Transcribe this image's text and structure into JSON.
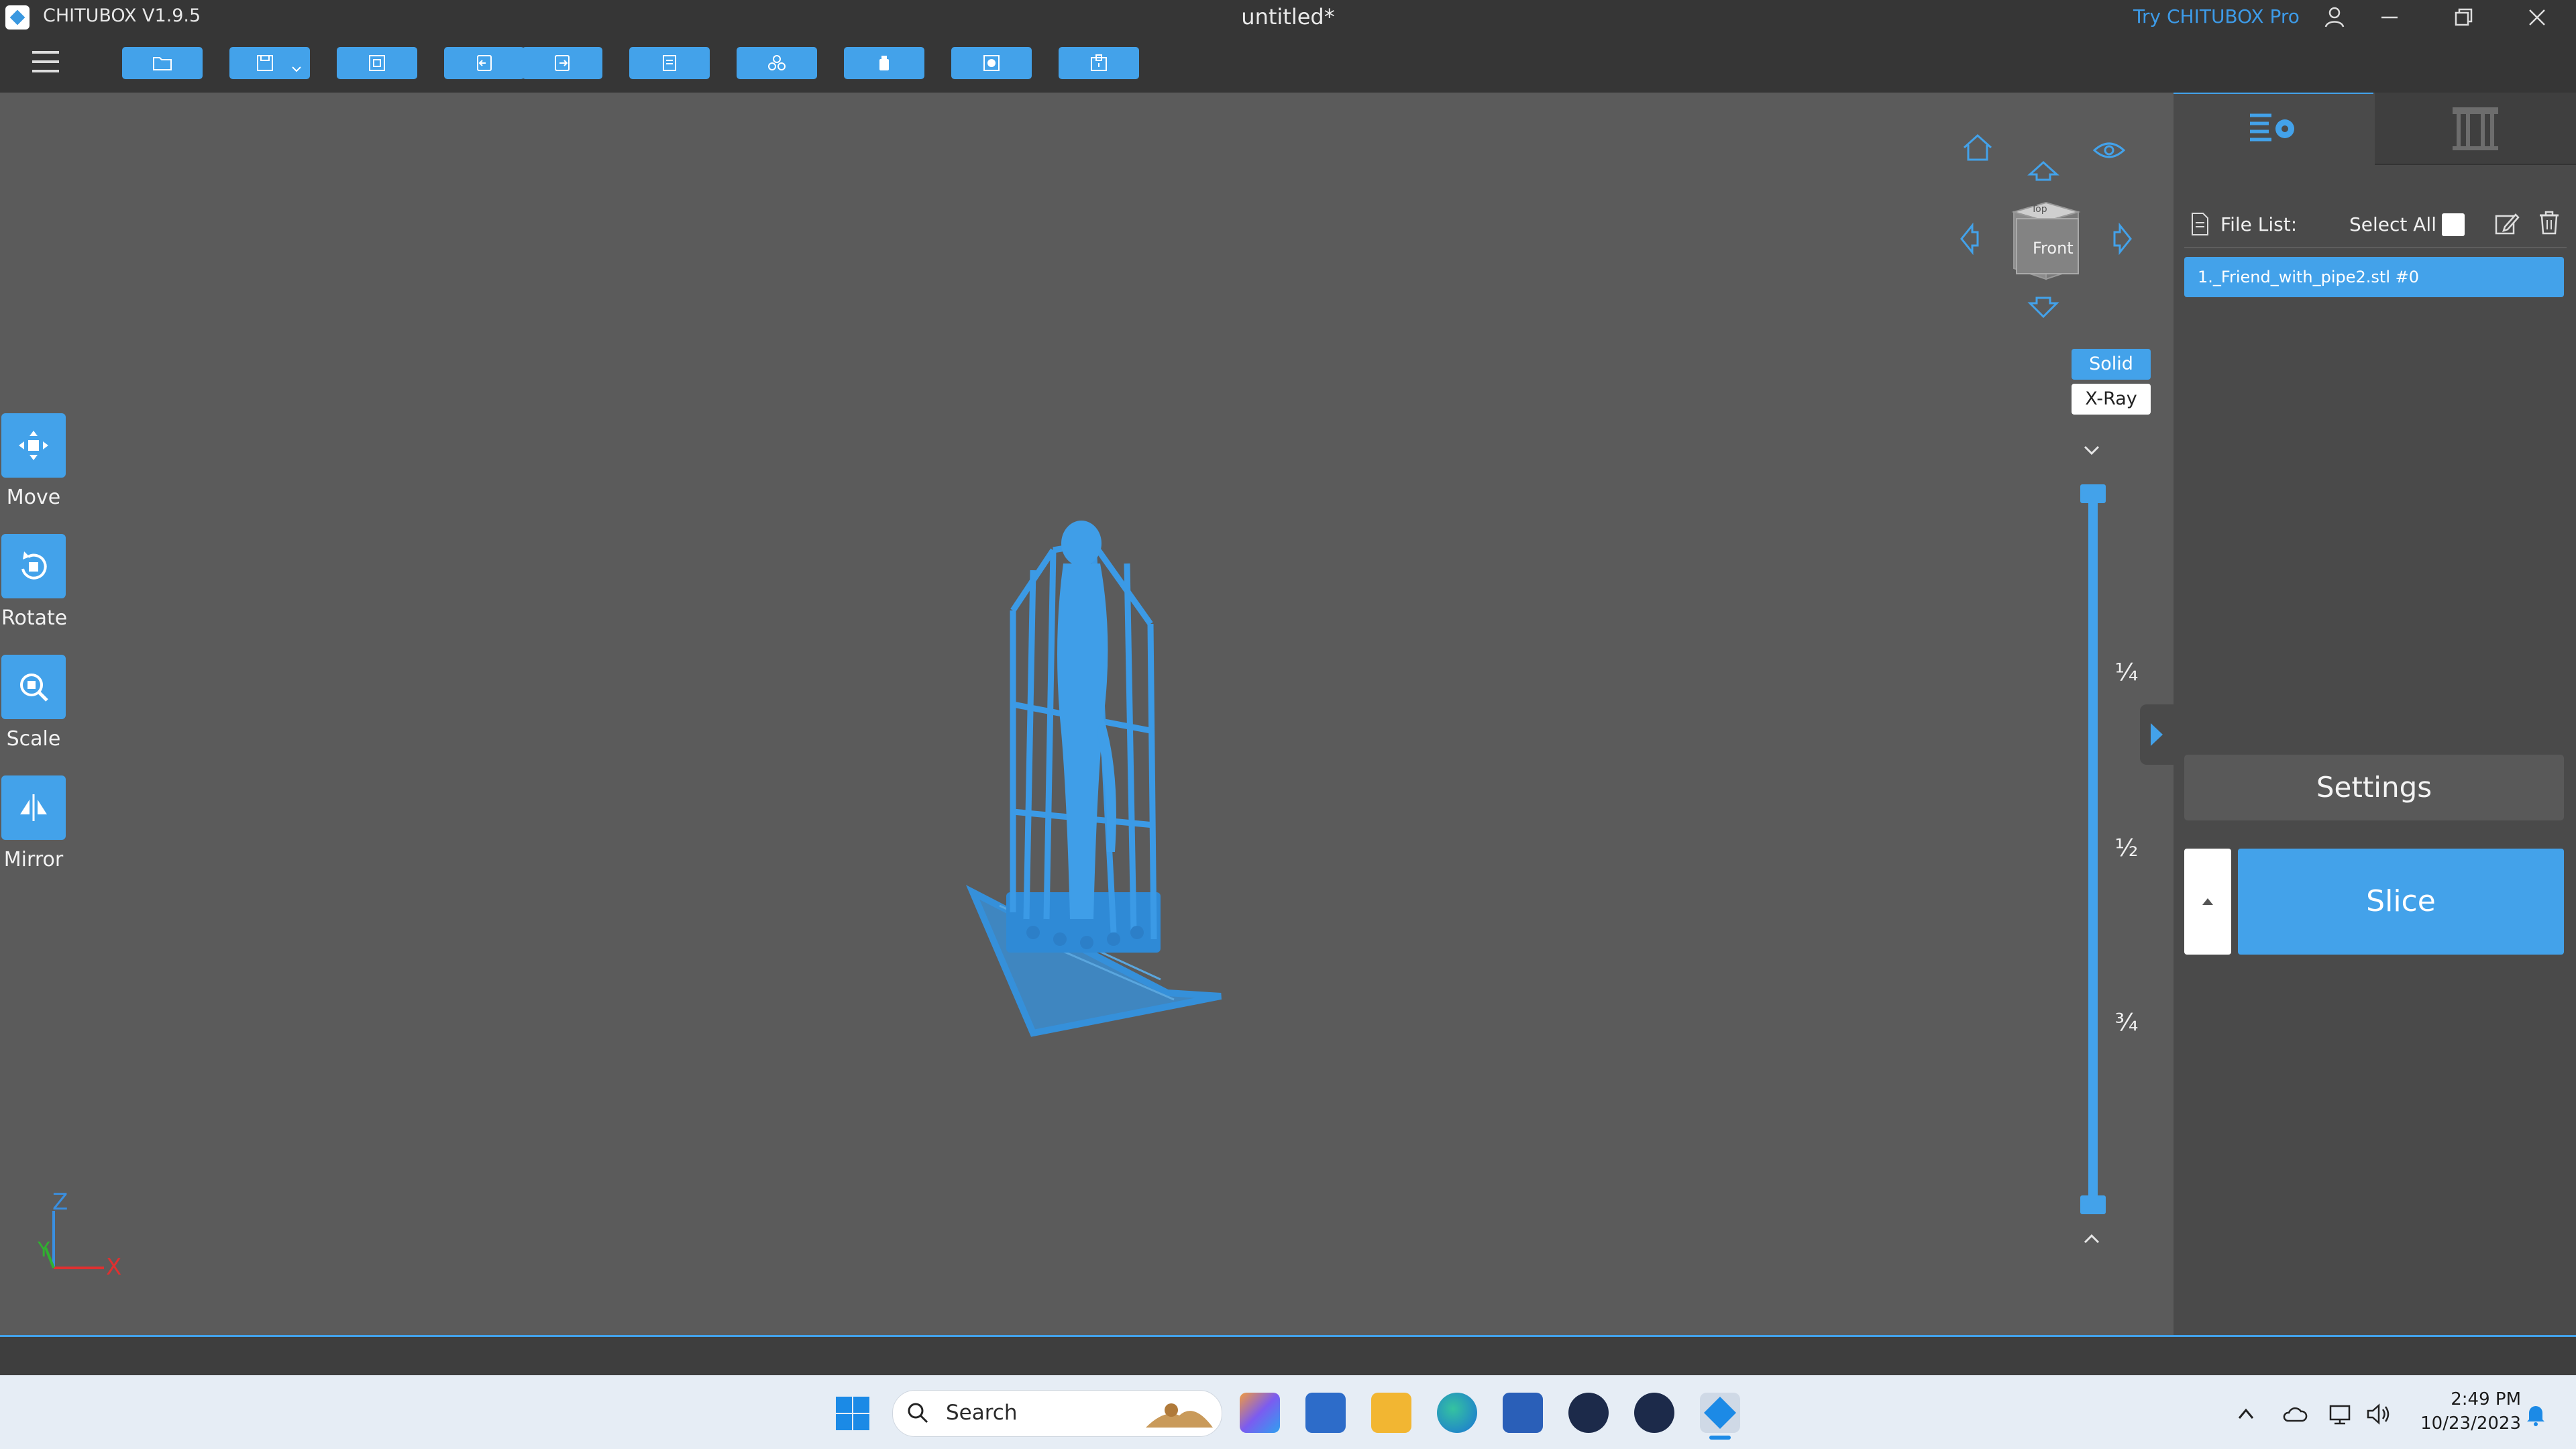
{
  "titlebar": {
    "app_title": "CHITUBOX V1.9.5",
    "doc_title": "untitled*",
    "try_pro": "Try CHITUBOX Pro",
    "icons": [
      "user-icon",
      "minimize-icon",
      "restore-icon",
      "close-icon"
    ]
  },
  "toolbar": {
    "buttons": [
      "open-file",
      "save",
      "auto-layout",
      "undo",
      "redo",
      "file-info",
      "duplicate",
      "hollow",
      "drain-hole",
      "print-plate"
    ]
  },
  "left_tools": [
    {
      "label": "Move",
      "icon": "move-icon"
    },
    {
      "label": "Rotate",
      "icon": "rotate-icon"
    },
    {
      "label": "Scale",
      "icon": "scale-icon"
    },
    {
      "label": "Mirror",
      "icon": "mirror-icon"
    }
  ],
  "view": {
    "cube_face": "Front",
    "cube_top": "Top",
    "modes": {
      "solid": "Solid",
      "xray": "X-Ray"
    },
    "active_mode": "Solid",
    "slider_marks": [
      "¼",
      "½",
      "¾"
    ]
  },
  "axes": {
    "z": "Z",
    "y": "Y",
    "x": "X"
  },
  "panel": {
    "file_list_label": "File List:",
    "select_all_label": "Select All",
    "files": [
      "1._Friend_with_pipe2.stl #0"
    ],
    "settings_label": "Settings",
    "slice_label": "Slice"
  },
  "taskbar": {
    "search_label": "Search",
    "time": "2:49 PM",
    "date": "10/23/2023"
  },
  "colors": {
    "accent": "#43a2ea",
    "titlebar": "#363636",
    "viewport": "#5b5b5b",
    "panel": "#4a4a4a"
  }
}
